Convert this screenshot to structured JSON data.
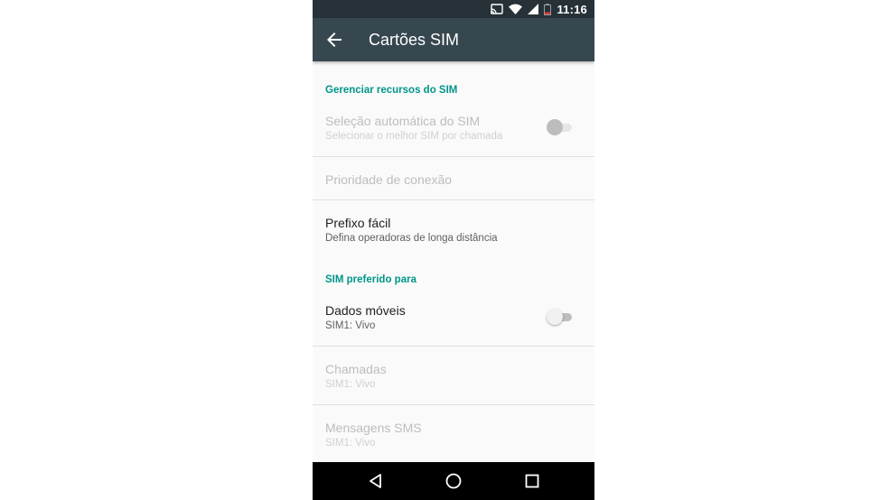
{
  "status_bar": {
    "time": "11:16",
    "icons": [
      "cast-icon",
      "wifi-icon",
      "signal-icon",
      "battery-icon"
    ]
  },
  "app_bar": {
    "title": "Cartões SIM",
    "back_icon": "arrow-back-icon"
  },
  "colors": {
    "status_bar": "#263238",
    "app_bar": "#37474f",
    "accent": "#009688",
    "background": "#fafafa",
    "nav_bar": "#000000"
  },
  "sections": {
    "manage": {
      "header": "Gerenciar recursos do SIM",
      "auto_select": {
        "title": "Seleção automática do SIM",
        "summary": "Selecionar o melhor SIM por chamada",
        "enabled": false,
        "checked": false
      },
      "priority": {
        "title": "Prioridade de conexão",
        "enabled": false
      },
      "prefix": {
        "title": "Prefixo fácil",
        "summary": "Defina operadoras de longa distância",
        "enabled": true
      }
    },
    "preferred": {
      "header": "SIM preferido para",
      "mobile_data": {
        "title": "Dados móveis",
        "summary": "SIM1: Vivo",
        "enabled": true,
        "checked": false
      },
      "calls": {
        "title": "Chamadas",
        "summary": "SIM1: Vivo",
        "enabled": false
      },
      "sms": {
        "title": "Mensagens SMS",
        "summary": "SIM1: Vivo",
        "enabled": false
      }
    }
  },
  "nav_bar": {
    "icons": [
      "back-triangle-icon",
      "home-circle-icon",
      "recents-square-icon"
    ]
  }
}
